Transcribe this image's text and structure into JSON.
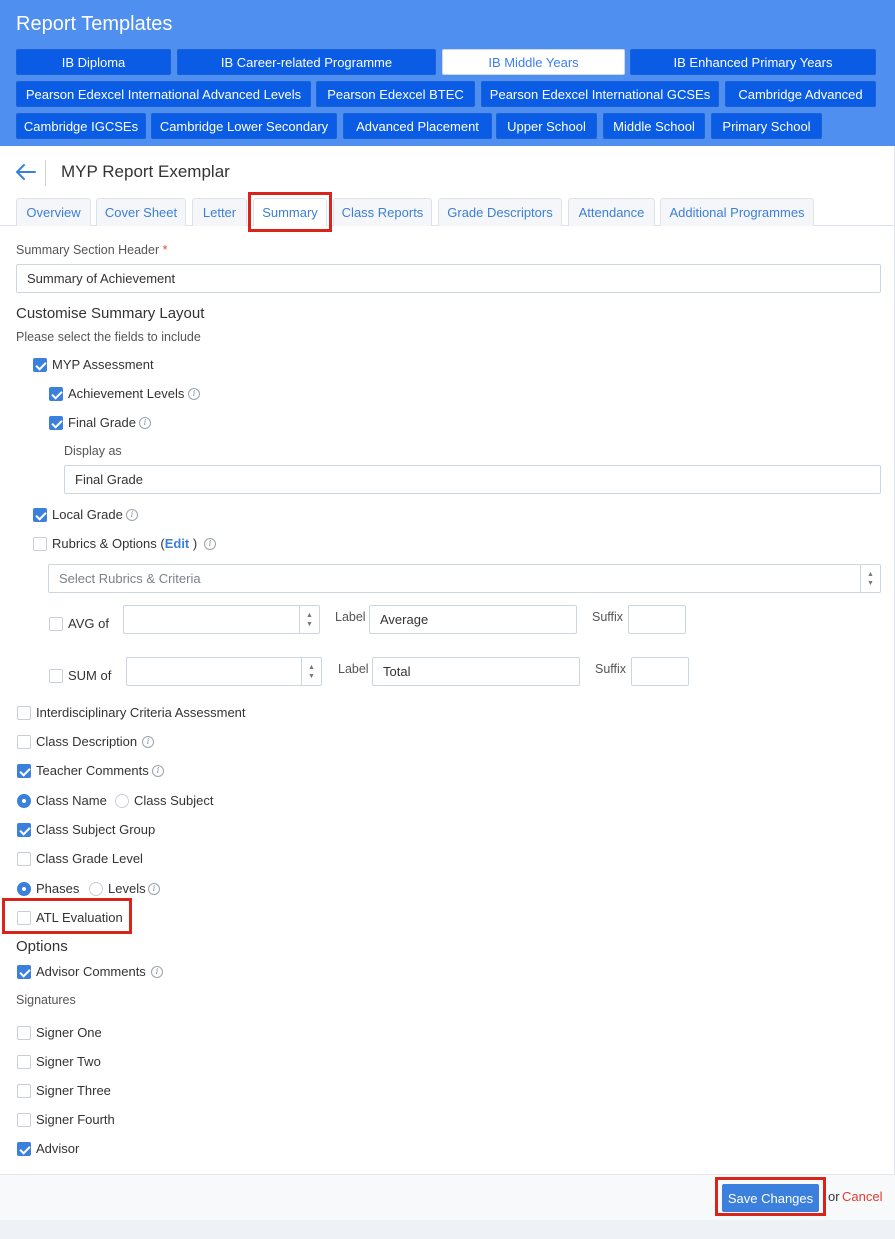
{
  "header": {
    "title": "Report Templates",
    "templates": [
      "IB Diploma",
      "IB Career-related Programme",
      "IB Middle Years",
      "IB Enhanced Primary Years",
      "Pearson Edexcel International Advanced Levels",
      "Pearson Edexcel BTEC",
      "Pearson Edexcel International GCSEs",
      "Cambridge Advanced",
      "Cambridge IGCSEs",
      "Cambridge Lower Secondary",
      "Advanced Placement",
      "Upper School",
      "Middle School",
      "Primary School"
    ],
    "active_template": "IB Middle Years"
  },
  "page": {
    "title": "MYP Report Exemplar"
  },
  "tabs": [
    "Overview",
    "Cover Sheet",
    "Letter",
    "Summary",
    "Class Reports",
    "Grade Descriptors",
    "Attendance",
    "Additional Programmes"
  ],
  "active_tab": "Summary",
  "form": {
    "header_label": "Summary Section Header",
    "required_mark": "*",
    "header_value": "Summary of Achievement",
    "customise_title": "Customise Summary Layout",
    "customise_hint": "Please select the fields to include",
    "myp_assessment": {
      "label": "MYP Assessment",
      "checked": true
    },
    "achievement_levels": {
      "label": "Achievement Levels",
      "checked": true
    },
    "final_grade": {
      "label": "Final Grade",
      "checked": true
    },
    "display_as_label": "Display as",
    "display_as_value": "Final Grade",
    "local_grade": {
      "label": "Local Grade",
      "checked": true
    },
    "rubrics": {
      "label": "Rubrics & Options (",
      "edit": "Edit",
      "close": " )",
      "checked": false
    },
    "rubrics_placeholder": "Select Rubrics & Criteria",
    "avg": {
      "label": "AVG of",
      "label_text": "Label",
      "label_value": "Average",
      "suffix_text": "Suffix"
    },
    "sum": {
      "label": "SUM of",
      "label_text": "Label",
      "label_value": "Total",
      "suffix_text": "Suffix"
    },
    "interdisciplinary": {
      "label": "Interdisciplinary Criteria Assessment",
      "checked": false
    },
    "class_description": {
      "label": "Class Description",
      "checked": false
    },
    "teacher_comments": {
      "label": "Teacher Comments",
      "checked": true
    },
    "class_name_radio": {
      "label": "Class Name",
      "selected": true
    },
    "class_subject_radio": {
      "label": "Class Subject",
      "selected": false
    },
    "class_subject_group": {
      "label": "Class Subject Group",
      "checked": true
    },
    "class_grade_level": {
      "label": "Class Grade Level",
      "checked": false
    },
    "phases_radio": {
      "label": "Phases",
      "selected": true
    },
    "levels_radio": {
      "label": "Levels",
      "selected": false
    },
    "atl_evaluation": {
      "label": "ATL Evaluation",
      "checked": false
    },
    "options_title": "Options",
    "advisor_comments": {
      "label": "Advisor Comments",
      "checked": true
    },
    "signatures_title": "Signatures",
    "signers": [
      {
        "label": "Signer One",
        "checked": false
      },
      {
        "label": "Signer Two",
        "checked": false
      },
      {
        "label": "Signer Three",
        "checked": false
      },
      {
        "label": "Signer Fourth",
        "checked": false
      },
      {
        "label": "Advisor",
        "checked": true
      }
    ]
  },
  "footer": {
    "save_label": "Save Changes",
    "or_text": "or",
    "cancel_label": "Cancel"
  },
  "colors": {
    "header_bg": "#4f8ff0",
    "button_bg": "#0a5ce5",
    "accent": "#3b80dc",
    "highlight": "#d9241b",
    "cancel": "#e23b2e"
  }
}
